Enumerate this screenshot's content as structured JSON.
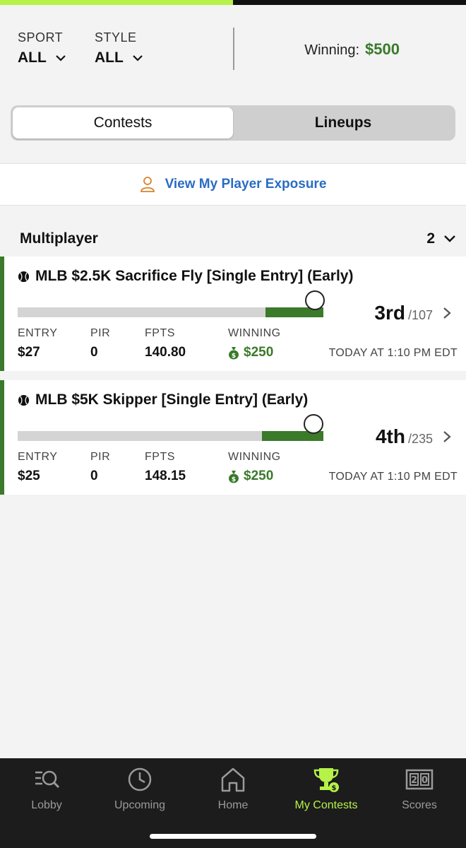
{
  "progress": {
    "fraction": 0.5,
    "color": "#b6f24a"
  },
  "filters": {
    "sport": {
      "label": "SPORT",
      "value": "ALL"
    },
    "style": {
      "label": "STYLE",
      "value": "ALL"
    },
    "winning_label": "Winning:",
    "winning_value": "$500"
  },
  "segment": {
    "active": "Contests",
    "inactive": "Lineups"
  },
  "exposure": {
    "label": "View My Player Exposure"
  },
  "section": {
    "title": "Multiplayer",
    "count": "2"
  },
  "contests": [
    {
      "name": "MLB $2.5K Sacrifice Fly [Single Entry] (Early)",
      "standing_fraction": 0.19,
      "place": "3rd",
      "of": "/107",
      "entry_label": "ENTRY",
      "entry": "$27",
      "pir_label": "PIR",
      "pir": "0",
      "fpts_label": "FPTS",
      "fpts": "140.80",
      "winning_label": "WINNING",
      "winning": "$250",
      "when": "TODAY AT 1:10 PM EDT"
    },
    {
      "name": "MLB $5K Skipper [Single Entry] (Early)",
      "standing_fraction": 0.2,
      "place": "4th",
      "of": "/235",
      "entry_label": "ENTRY",
      "entry": "$25",
      "pir_label": "PIR",
      "pir": "0",
      "fpts_label": "FPTS",
      "fpts": "148.15",
      "winning_label": "WINNING",
      "winning": "$250",
      "when": "TODAY AT 1:10 PM EDT"
    }
  ],
  "tabs": [
    {
      "label": "Lobby",
      "icon": "lobby-icon"
    },
    {
      "label": "Upcoming",
      "icon": "clock-icon"
    },
    {
      "label": "Home",
      "icon": "home-icon"
    },
    {
      "label": "My Contests",
      "icon": "trophy-icon",
      "active": true
    },
    {
      "label": "Scores",
      "icon": "scoreboard-icon"
    }
  ],
  "colors": {
    "accent_green": "#3a7a2a",
    "active_tab": "#b6f24a",
    "link_blue": "#2a6cc4"
  }
}
